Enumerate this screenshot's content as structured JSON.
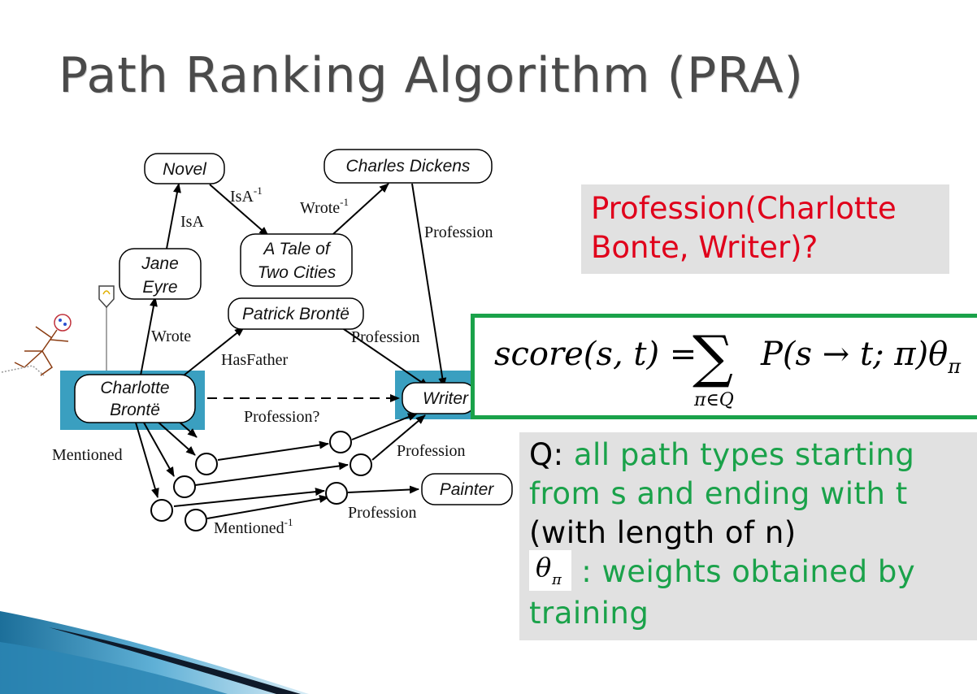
{
  "title": "Path Ranking Algorithm (PRA)",
  "graph": {
    "nodes": {
      "novel": "Novel",
      "dickens": "Charles Dickens",
      "tale_line1": "A Tale of",
      "tale_line2": "Two Cities",
      "jane_line1": "Jane",
      "jane_line2": "Eyre",
      "patrick": "Patrick Brontë",
      "charlotte_line1": "Charlotte",
      "charlotte_line2": "Brontë",
      "writer": "Writer",
      "painter": "Painter"
    },
    "edges": {
      "isa": "IsA",
      "isa_inv": "IsA",
      "isa_inv_sup": "-1",
      "wrote_inv": "Wrote",
      "wrote_inv_sup": "-1",
      "profession_dickens": "Profession",
      "wrote": "Wrote",
      "hasfather": "HasFather",
      "profession_patrick": "Profession",
      "profession_query": "Profession?",
      "mentioned": "Mentioned",
      "profession_paths": "Profession",
      "profession_painter": "Profession",
      "mentioned_inv": "Mentioned",
      "mentioned_inv_sup": "-1"
    }
  },
  "query": {
    "line1": "Profession(Charlotte",
    "line2": "Bonte, Writer)?"
  },
  "formula": {
    "lhs": "score(s, t) =",
    "sum": "∑",
    "sub": "π∈Q",
    "rhs": "P(s → t; π)θ",
    "rhs_sub": "π"
  },
  "explanation": {
    "q_label": "Q:",
    "q_line1": " all path types starting",
    "q_line2": "from s and ending with t",
    "q_line3": "(with length of n)",
    "theta": "θ",
    "theta_sub": "π",
    "theta_line1": " : weights obtained by",
    "theta_line2": "training"
  },
  "colors": {
    "query_red": "#e0001b",
    "green": "#1aa24a",
    "panel_gray": "#e1e1e1",
    "highlight_blue": "#3a9fc0"
  }
}
